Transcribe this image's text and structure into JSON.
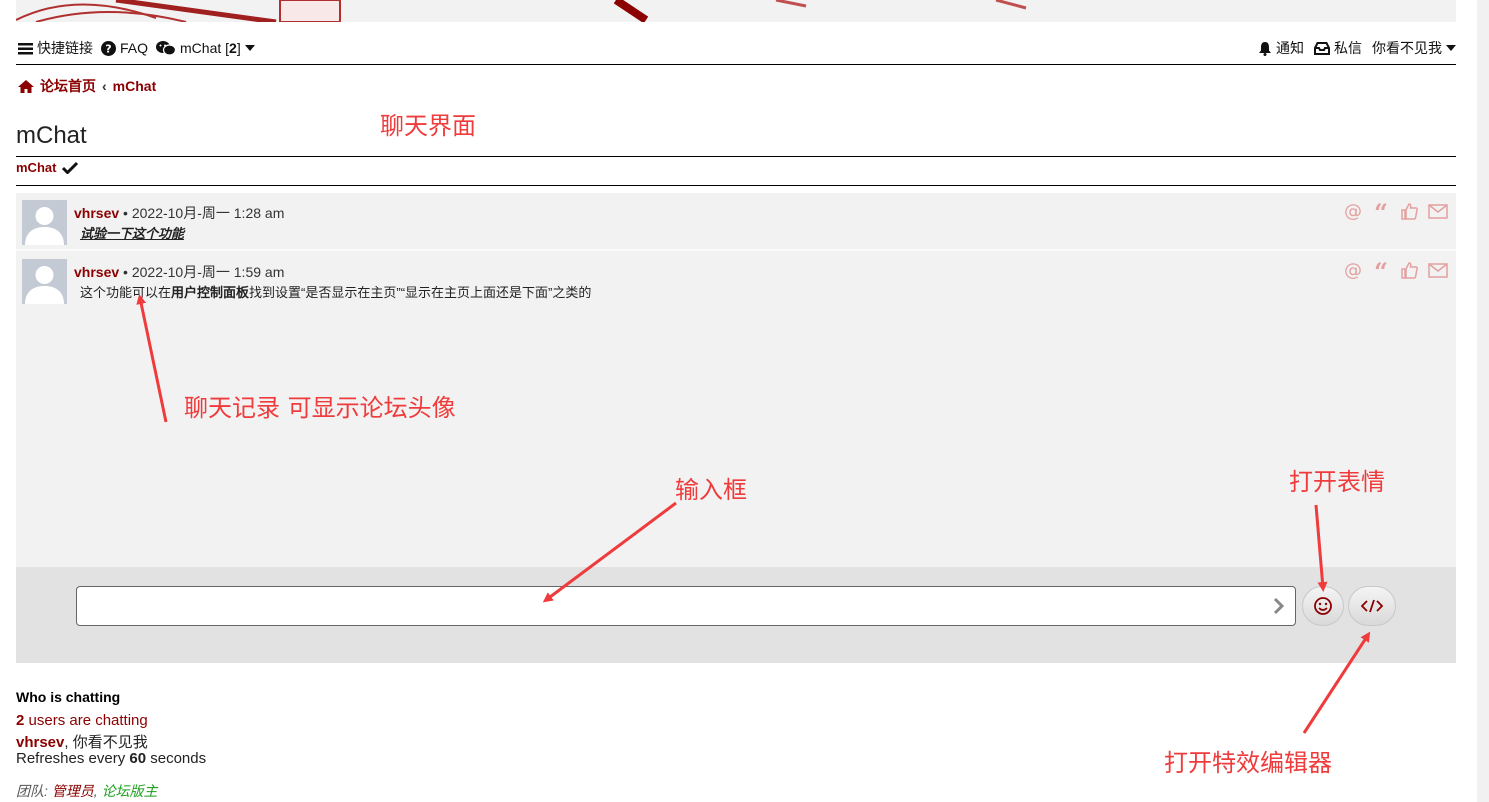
{
  "navbar": {
    "quick_links": "快捷链接",
    "faq": "FAQ",
    "mchat": "mChat",
    "mchat_count_open": " [",
    "mchat_count": "2",
    "mchat_count_close": "]",
    "notifications": "通知",
    "messages": "私信",
    "username": "你看不见我"
  },
  "breadcrumb": {
    "home": "论坛首页",
    "separator": "‹",
    "current": "mChat"
  },
  "page": {
    "title": "mChat",
    "subtab": "mChat"
  },
  "messages": [
    {
      "author": "vhrsev",
      "separator": " • ",
      "time": "2022-10月-周一 1:28 am",
      "text": "试验一下这个功能"
    },
    {
      "author": "vhrsev",
      "separator": " • ",
      "time": "2022-10月-周一 1:59 am",
      "text_pre": "这个功能可以在",
      "text_bold": "用户控制面板",
      "text_post": "找到设置“是否显示在主页”“显示在主页上面还是下面”之类的"
    }
  ],
  "input": {
    "placeholder": ""
  },
  "who": {
    "title": "Who is chatting",
    "count": "2",
    "count_suffix": " users are chatting",
    "user1": "vhrsev",
    "user_sep": ", ",
    "user2": "你看不见我",
    "refresh_pre": "Refreshes every ",
    "refresh_num": "60",
    "refresh_post": " seconds"
  },
  "team": {
    "label": "团队: ",
    "admin": "管理员",
    "sep": ", ",
    "mod": "论坛版主"
  },
  "annotations": {
    "chat_ui": "聊天界面",
    "history": "聊天记录 可显示论坛头像",
    "input_box": "输入框",
    "emoji": "打开表情",
    "editor": "打开特效编辑器"
  },
  "colors": {
    "brand": "#8b0000",
    "annotation": "#ef3b3b",
    "moderator": "#1fa01f"
  }
}
